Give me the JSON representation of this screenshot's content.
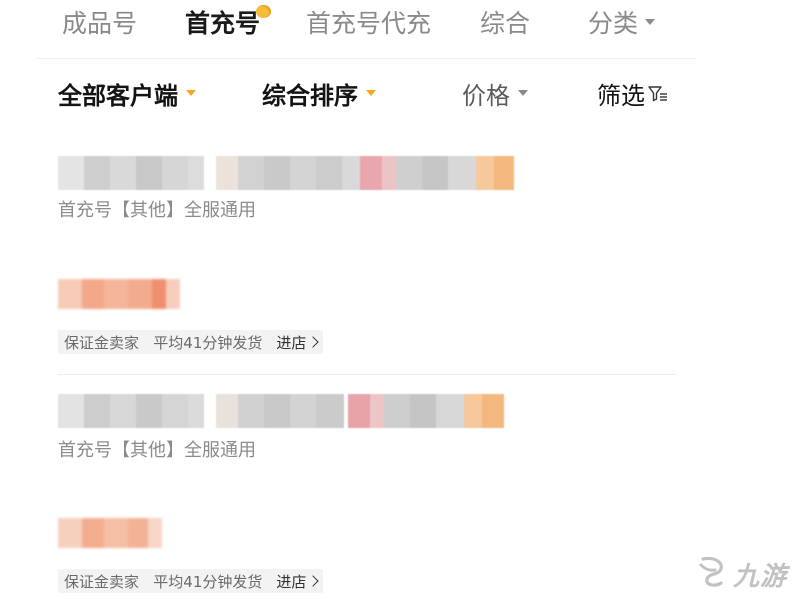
{
  "tabs": [
    {
      "label": "成品号",
      "active": false
    },
    {
      "label": "首充号",
      "active": true
    },
    {
      "label": "首充号代充",
      "active": false
    },
    {
      "label": "综合",
      "active": false
    },
    {
      "label": "分类",
      "active": false,
      "dropdown": true
    }
  ],
  "filters": {
    "client": "全部客户端",
    "sort": "综合排序",
    "price": "价格",
    "screen": "筛选"
  },
  "listings": [
    {
      "subtitle": "首充号【其他】全服通用",
      "badge": "保证金卖家   平均41分钟发货",
      "shop_link": "进店"
    },
    {
      "subtitle": "首充号【其他】全服通用",
      "badge": "保证金卖家   平均41分钟发货",
      "shop_link": "进店"
    }
  ],
  "colors": {
    "accent": "#f5a623",
    "active_text": "#1a1a1a",
    "muted_text": "#8a8a8a"
  },
  "watermark": {
    "text": "九游",
    "icon": "jiuyou-logo-icon"
  }
}
